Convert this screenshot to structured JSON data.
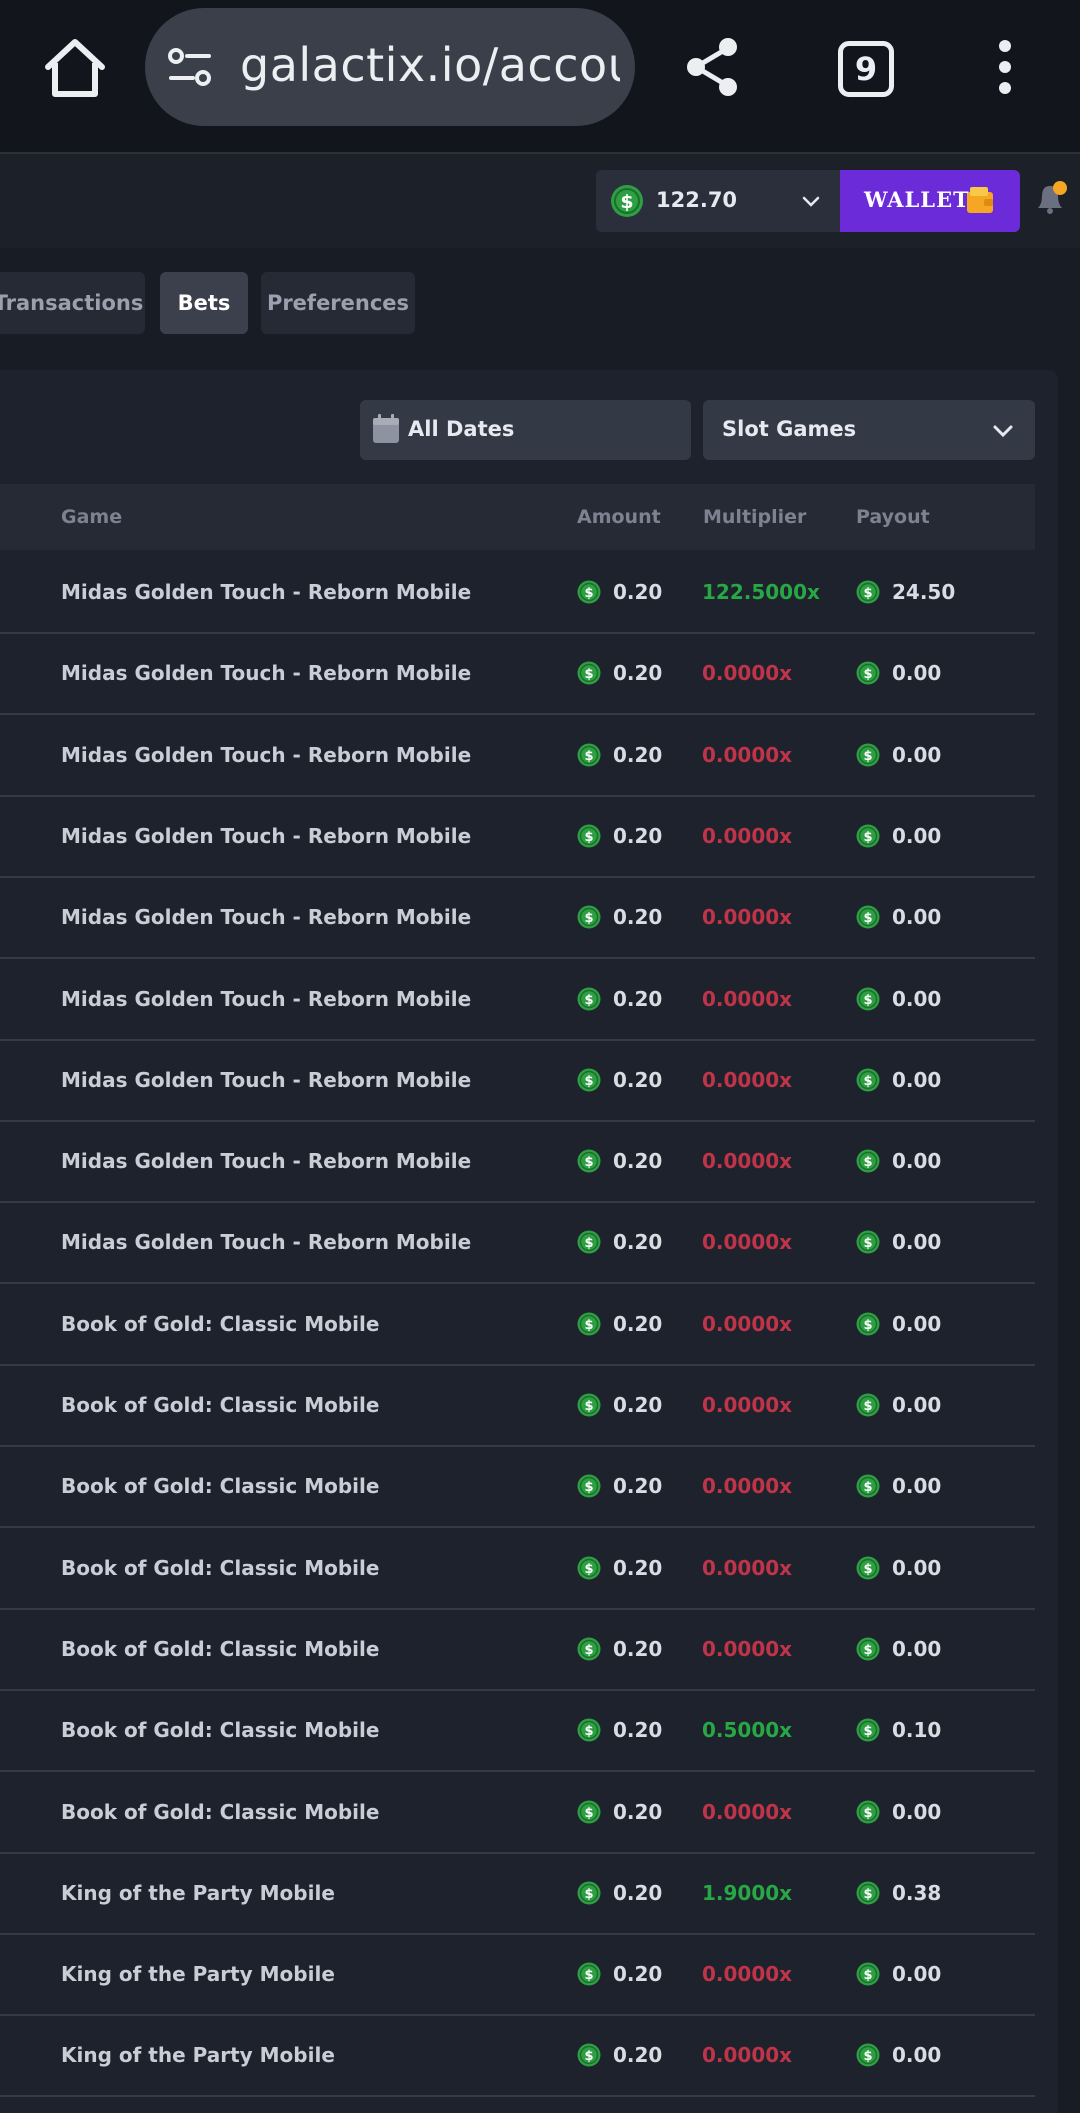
{
  "browser": {
    "url": "galactix.io/accou",
    "tab_count": "9"
  },
  "header": {
    "balance": "122.70",
    "wallet_label": "WALLET"
  },
  "tabs": [
    {
      "label": "Transactions",
      "active": false
    },
    {
      "label": "Bets",
      "active": true
    },
    {
      "label": "Preferences",
      "active": false
    }
  ],
  "filters": {
    "date": "All Dates",
    "category": "Slot Games"
  },
  "table": {
    "columns": {
      "game": "Game",
      "amount": "Amount",
      "multiplier": "Multiplier",
      "payout": "Payout"
    },
    "rows": [
      {
        "game": "Midas Golden Touch - Reborn Mobile",
        "amount": "0.20",
        "multiplier": "122.5000x",
        "payout": "24.50",
        "win": true
      },
      {
        "game": "Midas Golden Touch - Reborn Mobile",
        "amount": "0.20",
        "multiplier": "0.0000x",
        "payout": "0.00",
        "win": false
      },
      {
        "game": "Midas Golden Touch - Reborn Mobile",
        "amount": "0.20",
        "multiplier": "0.0000x",
        "payout": "0.00",
        "win": false
      },
      {
        "game": "Midas Golden Touch - Reborn Mobile",
        "amount": "0.20",
        "multiplier": "0.0000x",
        "payout": "0.00",
        "win": false
      },
      {
        "game": "Midas Golden Touch - Reborn Mobile",
        "amount": "0.20",
        "multiplier": "0.0000x",
        "payout": "0.00",
        "win": false
      },
      {
        "game": "Midas Golden Touch - Reborn Mobile",
        "amount": "0.20",
        "multiplier": "0.0000x",
        "payout": "0.00",
        "win": false
      },
      {
        "game": "Midas Golden Touch - Reborn Mobile",
        "amount": "0.20",
        "multiplier": "0.0000x",
        "payout": "0.00",
        "win": false
      },
      {
        "game": "Midas Golden Touch - Reborn Mobile",
        "amount": "0.20",
        "multiplier": "0.0000x",
        "payout": "0.00",
        "win": false
      },
      {
        "game": "Midas Golden Touch - Reborn Mobile",
        "amount": "0.20",
        "multiplier": "0.0000x",
        "payout": "0.00",
        "win": false
      },
      {
        "game": "Book of Gold: Classic Mobile",
        "amount": "0.20",
        "multiplier": "0.0000x",
        "payout": "0.00",
        "win": false
      },
      {
        "game": "Book of Gold: Classic Mobile",
        "amount": "0.20",
        "multiplier": "0.0000x",
        "payout": "0.00",
        "win": false
      },
      {
        "game": "Book of Gold: Classic Mobile",
        "amount": "0.20",
        "multiplier": "0.0000x",
        "payout": "0.00",
        "win": false
      },
      {
        "game": "Book of Gold: Classic Mobile",
        "amount": "0.20",
        "multiplier": "0.0000x",
        "payout": "0.00",
        "win": false
      },
      {
        "game": "Book of Gold: Classic Mobile",
        "amount": "0.20",
        "multiplier": "0.0000x",
        "payout": "0.00",
        "win": false
      },
      {
        "game": "Book of Gold: Classic Mobile",
        "amount": "0.20",
        "multiplier": "0.5000x",
        "payout": "0.10",
        "win": true
      },
      {
        "game": "Book of Gold: Classic Mobile",
        "amount": "0.20",
        "multiplier": "0.0000x",
        "payout": "0.00",
        "win": false
      },
      {
        "game": "King of the Party Mobile",
        "amount": "0.20",
        "multiplier": "1.9000x",
        "payout": "0.38",
        "win": true
      },
      {
        "game": "King of the Party Mobile",
        "amount": "0.20",
        "multiplier": "0.0000x",
        "payout": "0.00",
        "win": false
      },
      {
        "game": "King of the Party Mobile",
        "amount": "0.20",
        "multiplier": "0.0000x",
        "payout": "0.00",
        "win": false
      }
    ]
  },
  "colors": {
    "background": "#181c25",
    "panel": "#1e222c",
    "wallet": "#6b2bd9",
    "win": "#27a844",
    "loss": "#c0344a",
    "coin": "#2ea043"
  }
}
